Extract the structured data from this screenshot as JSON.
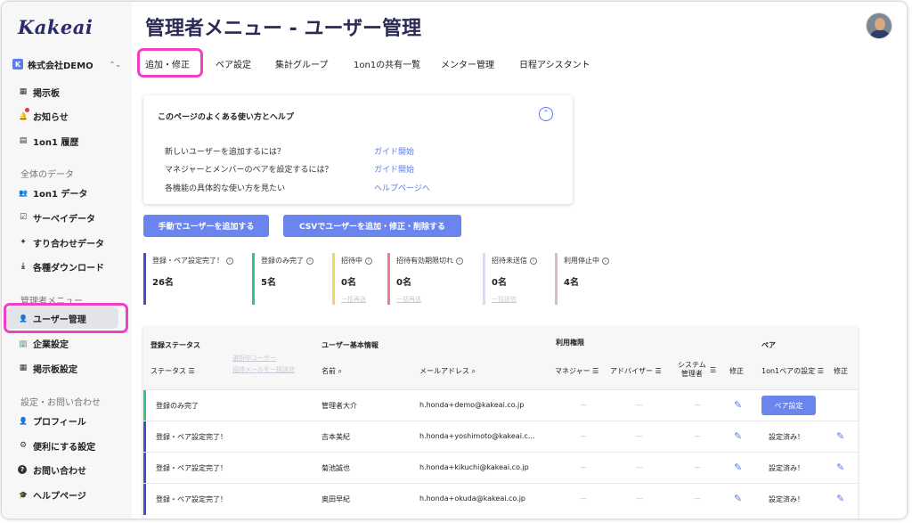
{
  "sidebar": {
    "logo": "Kakeai",
    "company": {
      "badge": "K",
      "name": "株式会社DEMO",
      "switch": "⌃⌄"
    },
    "items_top": [
      {
        "icon": "bulletin-board-icon",
        "glyph": "▦",
        "label": "掲示板"
      },
      {
        "icon": "bell-icon",
        "glyph": "🔔",
        "label": "お知らせ"
      },
      {
        "icon": "history-icon",
        "glyph": "▤",
        "label": "1on1 履歴"
      }
    ],
    "section_data": "全体のデータ",
    "items_data": [
      {
        "icon": "people-icon",
        "glyph": "👥",
        "label": "1on1 データ"
      },
      {
        "icon": "survey-icon",
        "glyph": "☑",
        "label": "サーベイデータ"
      },
      {
        "icon": "puzzle-icon",
        "glyph": "✦",
        "label": "すり合わせデータ"
      },
      {
        "icon": "download-icon",
        "glyph": "⤓",
        "label": "各種ダウンロード"
      }
    ],
    "section_admin": "管理者メニュー",
    "items_admin": [
      {
        "icon": "user-manage-icon",
        "glyph": "👤",
        "label": "ユーザー管理"
      },
      {
        "icon": "company-icon",
        "glyph": "🏢",
        "label": "企業設定"
      },
      {
        "icon": "board-settings-icon",
        "glyph": "▦",
        "label": "掲示板設定"
      }
    ],
    "section_settings": "設定・お問い合わせ",
    "items_settings": [
      {
        "icon": "profile-icon",
        "glyph": "👤",
        "label": "プロフィール"
      },
      {
        "icon": "gear-icon",
        "glyph": "⚙",
        "label": "便利にする設定"
      },
      {
        "icon": "question-icon",
        "glyph": "?",
        "label": "お問い合わせ"
      },
      {
        "icon": "help-icon",
        "glyph": "🎓",
        "label": "ヘルプページ"
      }
    ]
  },
  "header": {
    "title": "管理者メニュー - ユーザー管理"
  },
  "tabs": [
    "追加・修正",
    "ペア設定",
    "集計グループ",
    "1on1の共有一覧",
    "メンター管理",
    "日程アシスタント"
  ],
  "help": {
    "title": "このページのよくある使い方とヘルプ",
    "toggle": "⌃",
    "rows": [
      {
        "q": "新しいユーザーを追加するには？",
        "link": "ガイド開始"
      },
      {
        "q": "マネジャーとメンバーのペアを設定するには？",
        "link": "ガイド開始"
      },
      {
        "q": "各機能の具体的な使い方を見たい",
        "link": "ヘルプページへ"
      }
    ]
  },
  "actions": {
    "manual_add": "手動でユーザーを追加する",
    "csv": "CSVでユーザーを追加・修正・削除する"
  },
  "stats": [
    {
      "label": "登録・ペア設定完了！",
      "count": "26名",
      "sub": "",
      "color": "#3f51c8"
    },
    {
      "label": "登録のみ完了",
      "count": "5名",
      "sub": "",
      "color": "#35c58a"
    },
    {
      "label": "招待中",
      "count": "0名",
      "sub": "一括再送",
      "color": "#f5d45a"
    },
    {
      "label": "招待有効期限切れ",
      "count": "0名",
      "sub": "一括再送",
      "color": "#ee7b8c"
    },
    {
      "label": "招待未送信",
      "count": "0名",
      "sub": "一括送信",
      "color": "#d8dcf0"
    },
    {
      "label": "利用停止中",
      "count": "4名",
      "sub": "",
      "color": "#d8bcbc"
    }
  ],
  "table": {
    "groups": {
      "status": "登録ステータス",
      "basic": "ユーザー基本情報",
      "perm": "利用権限",
      "pair": "ペア"
    },
    "faint_links": [
      "選択中ユーザー",
      "招待メールを一括送信"
    ],
    "cols": {
      "status": "ステータス",
      "name": "名前",
      "email": "メールアドレス",
      "manager": "マネジャー",
      "advisor": "アドバイザー",
      "sysadmin_1": "システム",
      "sysadmin_2": "管理者",
      "edit": "修正",
      "pair_setting": "1on1ペアの設定",
      "pair_edit": "修正"
    },
    "dash": "—",
    "rows": [
      {
        "status": "登録のみ完了",
        "name": "管理者大介",
        "email": "h.honda+demo@kakeai.co.jp",
        "pair": "ペア設定",
        "pair_is_button": true,
        "accent": "#35c58a"
      },
      {
        "status": "登録・ペア設定完了！",
        "name": "吉本美紀",
        "email": "h.honda+yoshimoto@kakeai.c...",
        "pair": "設定済み！",
        "pair_is_button": false,
        "accent": "#3f51c8"
      },
      {
        "status": "登録・ペア設定完了！",
        "name": "菊池誠也",
        "email": "h.honda+kikuchi@kakeai.co.jp",
        "pair": "設定済み！",
        "pair_is_button": false,
        "accent": "#3f51c8"
      },
      {
        "status": "登録・ペア設定完了！",
        "name": "奥田早紀",
        "email": "h.honda+okuda@kakeai.co.jp",
        "pair": "設定済み！",
        "pair_is_button": false,
        "accent": "#3f51c8"
      }
    ]
  },
  "colors": {
    "accent": "#6a86ee",
    "highlight": "#ef3fc4",
    "title": "#2b2b55"
  }
}
